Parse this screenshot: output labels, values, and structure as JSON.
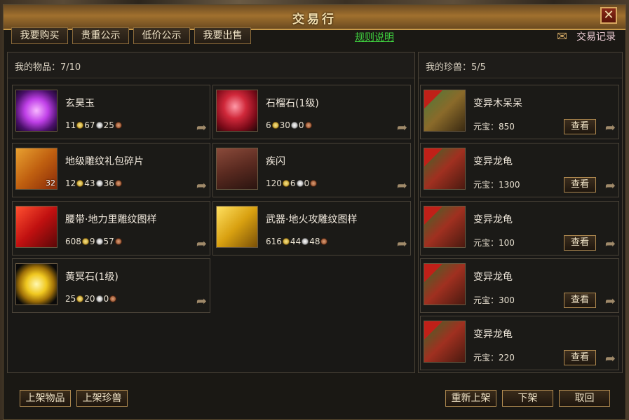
{
  "window": {
    "title": "交易行",
    "close_label": "✕"
  },
  "tabs": [
    "我要购买",
    "贵重公示",
    "低价公示",
    "我要出售"
  ],
  "links": {
    "rules": "规则说明",
    "records": "交易记录"
  },
  "items_panel": {
    "label": "我的物品：7/10",
    "items": [
      {
        "name": "玄昊玉",
        "gold": "11",
        "silver": "67",
        "copper": "25",
        "icon": "purple-orb-icon"
      },
      {
        "name": "石榴石(1级)",
        "gold": "6",
        "silver": "30",
        "copper": "0",
        "icon": "red-gem-icon"
      },
      {
        "name": "地级雕纹礼包碎片",
        "gold": "12",
        "silver": "43",
        "copper": "36",
        "icon": "gift-box-icon",
        "count": "32"
      },
      {
        "name": "疾闪",
        "gold": "120",
        "silver": "6",
        "copper": "0",
        "icon": "skill-silhouette-icon"
      },
      {
        "name": "腰带·地力里雕纹图样",
        "gold": "608",
        "silver": "9",
        "copper": "57",
        "icon": "red-banner-icon"
      },
      {
        "name": "武器·地火攻雕纹图样",
        "gold": "616",
        "silver": "44",
        "copper": "48",
        "icon": "gold-banner-icon"
      },
      {
        "name": "黄冥石(1级)",
        "gold": "25",
        "silver": "20",
        "copper": "0",
        "icon": "yellow-gem-icon"
      }
    ]
  },
  "pets_panel": {
    "label": "我的珍兽：5/5",
    "price_label": "元宝：",
    "view_label": "查看",
    "pets": [
      {
        "name": "变异木呆呆",
        "price": "850",
        "icon": "pet-tree-icon"
      },
      {
        "name": "变异龙龟",
        "price": "1300",
        "icon": "pet-dragon-turtle-icon"
      },
      {
        "name": "变异龙龟",
        "price": "100",
        "icon": "pet-dragon-turtle-icon"
      },
      {
        "name": "变异龙龟",
        "price": "300",
        "icon": "pet-dragon-turtle-icon"
      },
      {
        "name": "变异龙龟",
        "price": "220",
        "icon": "pet-dragon-turtle-icon"
      }
    ]
  },
  "bottom_buttons": {
    "list_item": "上架物品",
    "list_pet": "上架珍兽",
    "relist": "重新上架",
    "delist": "下架",
    "cancel": "取回"
  },
  "colors": {
    "link_green": "#3fd13f",
    "title_gold": "#f3dfae",
    "frame_border": "#8a6a3a"
  }
}
